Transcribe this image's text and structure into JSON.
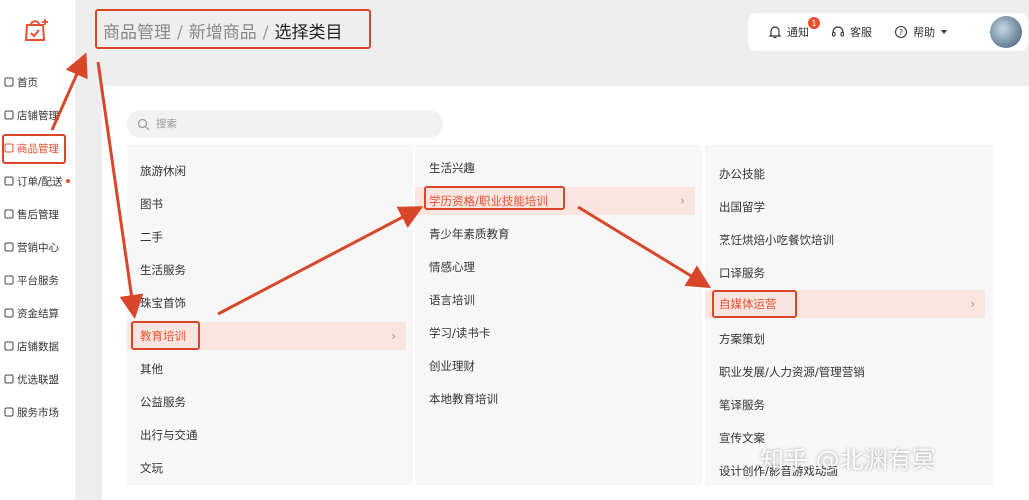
{
  "sidebar": {
    "logo_icon": "store-bag-icon",
    "items": [
      {
        "label": "首页",
        "icon": "home-icon"
      },
      {
        "label": "店铺管理",
        "icon": "shop-icon"
      },
      {
        "label": "商品管理",
        "icon": "bag-icon"
      },
      {
        "label": "订单/配送",
        "icon": "order-icon"
      },
      {
        "label": "售后管理",
        "icon": "headset-icon"
      },
      {
        "label": "营销中心",
        "icon": "ticket-icon"
      },
      {
        "label": "平台服务",
        "icon": "platform-icon"
      },
      {
        "label": "资金结算",
        "icon": "money-icon"
      },
      {
        "label": "店铺数据",
        "icon": "chart-icon"
      },
      {
        "label": "优选联盟",
        "icon": "network-icon"
      },
      {
        "label": "服务市场",
        "icon": "grid-icon"
      }
    ],
    "active_index": 2
  },
  "breadcrumb": {
    "part1": "商品管理",
    "sep": "/",
    "part2": "新增商品",
    "current": "选择类目"
  },
  "header": {
    "notify_label": "通知",
    "notify_badge": "1",
    "service_label": "客服",
    "help_label": "帮助"
  },
  "search": {
    "placeholder": "搜索"
  },
  "columns": {
    "col1": [
      "旅游休闲",
      "图书",
      "二手",
      "生活服务",
      "珠宝首饰",
      "教育培训",
      "其他",
      "公益服务",
      "出行与交通",
      "文玩"
    ],
    "col1_selected": 5,
    "col2": [
      "生活兴趣",
      "学历资格/职业技能培训",
      "青少年素质教育",
      "情感心理",
      "语言培训",
      "学习/读书卡",
      "创业理财",
      "本地教育培训"
    ],
    "col2_selected": 1,
    "col3": [
      "",
      "办公技能",
      "出国留学",
      "烹饪烘焙小吃餐饮培训",
      "口译服务",
      "自媒体运营",
      "方案策划",
      "职业发展/人力资源/管理营销",
      "笔译服务",
      "宣传文案",
      "设计创作/影音游戏动画"
    ],
    "col3_selected": 5
  },
  "watermark": "知乎 @北渊有冥",
  "colors": {
    "accent": "#e8502f",
    "annotation": "#d9472b"
  }
}
